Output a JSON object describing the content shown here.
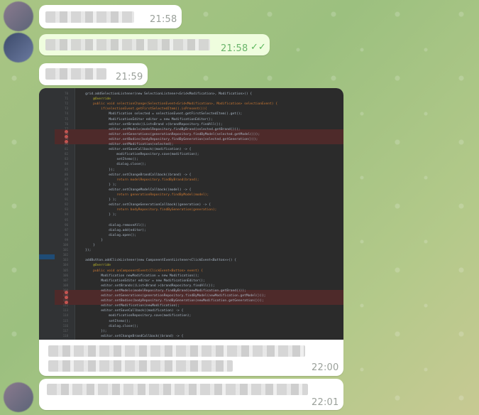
{
  "messages": [
    {
      "time": "21:58",
      "own": false
    },
    {
      "time": "21:58",
      "own": true,
      "status": "read"
    },
    {
      "time": "21:59",
      "own": false
    },
    {
      "time": "22:00",
      "own": false,
      "has_image": true
    },
    {
      "time": "22:01",
      "own": false
    }
  ],
  "code_image": {
    "lines": [
      "    grid.addSelectionListener(new SelectionListener<Grid<Modification>, Modification>() {",
      "        @Override",
      "        public void selectionChange(SelectionEvent<Grid<Modification>, Modification> selectionEvent) {",
      "            if(selectionEvent.getFirstSelectedItem().isPresent()){",
      "                Modification selected = selectionEvent.getFirstSelectedItem().get();",
      "                ModificationEditor editor = new ModificationEditor();",
      "                editor.setBrands((List<Brand >)brandRepository.findAll());",
      "                editor.setModels(modelRepository.findByBrand(selected.getBrand()));",
      "                editor.setGenerations(generationRepository.findByModel(selected.getModel()));",
      "                editor.setBodies(bodyRepository.findByGeneration(selected.getGeneration()));",
      "                editor.setModification(selected);",
      "                editor.setSaveCallback((modification) -> {",
      "                    modificationRepository.save(modification);",
      "                    setItems();",
      "                    dialog.close();",
      "                });",
      "                editor.setChangeBrandCallback((brand) -> {",
      "                    return modelRepository.findByBrand(brand);",
      "                } );",
      "                editor.setChangeModelCallback((model) -> {",
      "                    return generationRepository.findByModel(model);",
      "                } );",
      "                editor.setChangeGenerationCallback((generation) -> {",
      "                    return bodyRepository.findByGeneration(generation);",
      "                } );",
      "",
      "                dialog.removeAll();",
      "                dialog.add(editor);",
      "                dialog.open();",
      "            }",
      "        }",
      "    });",
      "",
      "    addButton.addClickListener(new ComponentEventListener<ClickEvent<Button>>() {",
      "        @Override",
      "        public void onComponentEvent(ClickEvent<Button> event) {",
      "            Modification newModification = new Modification();",
      "            ModificationEditor editor = new ModificationEditor();",
      "            editor.setBrands((List<Brand >)brandRepository.findAll());",
      "            editor.setModels(modelRepository.findByBrand(newModification.getBrand()));",
      "            editor.setGenerations(generationRepository.findByModel(newModification.getModel()));",
      "            editor.setBodies(bodyRepository.findByGeneration(newModification.getGeneration()));",
      "            editor.setModification(newModification);",
      "            editor.setSaveCallback((modification) -> {",
      "                modificationRepository.save(modification);",
      "                setItems();",
      "                dialog.close();",
      "            });",
      "            editor.setChangeBrandCallback((brand) -> {"
    ]
  }
}
